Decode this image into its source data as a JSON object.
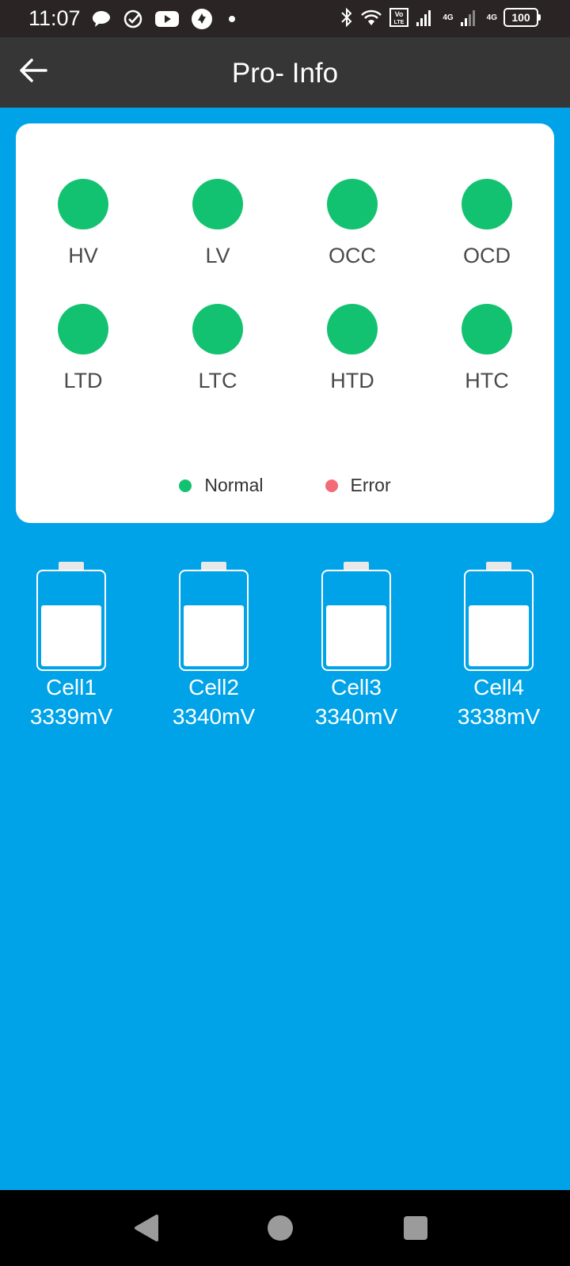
{
  "status_bar": {
    "time": "11:07",
    "icons_left": [
      "chat-bubble-icon",
      "check-circle-icon",
      "youtube-icon",
      "sync-icon",
      "dot-icon"
    ],
    "icons_right": [
      "bluetooth-icon",
      "wifi-icon",
      "volte-icon",
      "signal-icon",
      "signal-icon"
    ],
    "volte_label": "Vo LTE",
    "network_1": "4G",
    "network_2": "4G",
    "battery": "100"
  },
  "app_bar": {
    "title": "Pro- Info",
    "back_icon": "arrow-left-icon"
  },
  "colors": {
    "background": "#00a3e8",
    "normal": "#13c270",
    "error": "#f26b77"
  },
  "indicators": [
    {
      "label": "HV",
      "state": "normal"
    },
    {
      "label": "LV",
      "state": "normal"
    },
    {
      "label": "OCC",
      "state": "normal"
    },
    {
      "label": "OCD",
      "state": "normal"
    },
    {
      "label": "LTD",
      "state": "normal"
    },
    {
      "label": "LTC",
      "state": "normal"
    },
    {
      "label": "HTD",
      "state": "normal"
    },
    {
      "label": "HTC",
      "state": "normal"
    }
  ],
  "legend": {
    "normal_label": "Normal",
    "error_label": "Error"
  },
  "cells": [
    {
      "name": "Cell1",
      "voltage": "3339mV",
      "fill_level": 0.66
    },
    {
      "name": "Cell2",
      "voltage": "3340mV",
      "fill_level": 0.66
    },
    {
      "name": "Cell3",
      "voltage": "3340mV",
      "fill_level": 0.66
    },
    {
      "name": "Cell4",
      "voltage": "3338mV",
      "fill_level": 0.66
    }
  ],
  "nav_bar": {
    "buttons": [
      "back-triangle-icon",
      "home-circle-icon",
      "recents-square-icon"
    ]
  }
}
